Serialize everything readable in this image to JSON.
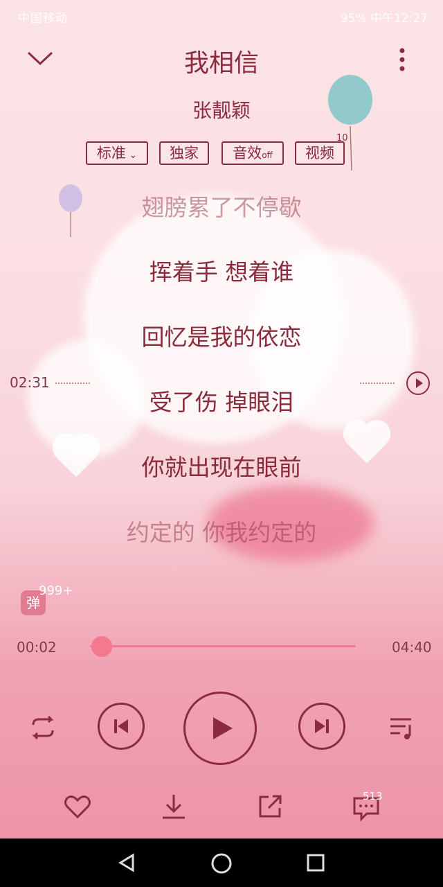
{
  "status_bar": {
    "carrier": "中国移动",
    "battery": "95%",
    "time": "中午12:27"
  },
  "header": {
    "song_title": "我相信",
    "artist": "张靓颖"
  },
  "tags": [
    {
      "label": "标准",
      "has_dropdown": true
    },
    {
      "label": "独家"
    },
    {
      "label": "音效",
      "suffix": "off"
    },
    {
      "label": "视频",
      "badge": "10"
    }
  ],
  "lyrics": {
    "lines": [
      "翅膀累了不停歇",
      "挥着手 想着谁",
      "回忆是我的依恋",
      "受了伤 掉眼泪",
      "你就出现在眼前",
      "约定的 你我约定的"
    ],
    "seek_time": "02:31"
  },
  "danmu": {
    "icon_label": "弹",
    "count": "999+"
  },
  "progress": {
    "current": "00:02",
    "duration": "04:40",
    "fraction": 0.007
  },
  "controls": {
    "comments_count": "513"
  },
  "colors": {
    "accent": "#8b2b3f",
    "progress": "#f4788e"
  }
}
